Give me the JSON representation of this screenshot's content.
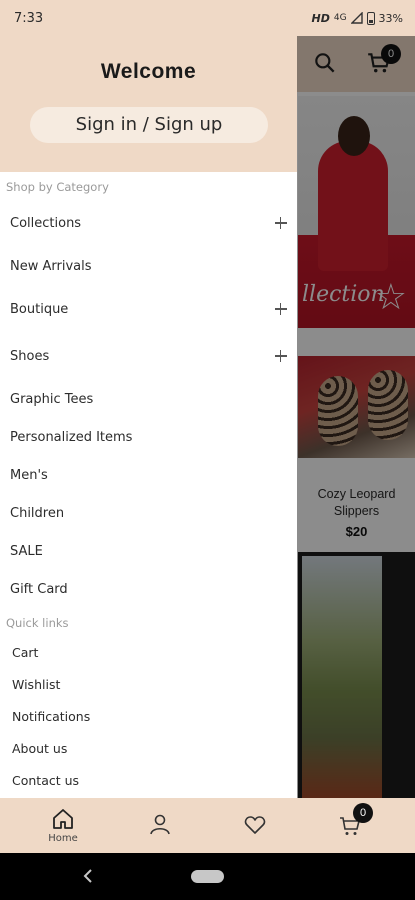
{
  "status_bar": {
    "time": "7:33",
    "network": "HD",
    "signal": "4G",
    "battery": "33%"
  },
  "header": {
    "cart_count": "0"
  },
  "drawer": {
    "welcome": "Welcome",
    "signin_label": "Sign in / Sign up",
    "category_title": "Shop by Category",
    "categories": [
      {
        "label": "Collections",
        "expandable": true
      },
      {
        "label": "New Arrivals",
        "expandable": false
      },
      {
        "label": "Boutique",
        "expandable": true
      },
      {
        "label": "Shoes",
        "expandable": true
      },
      {
        "label": "Graphic Tees",
        "expandable": false
      },
      {
        "label": "Personalized Items",
        "expandable": false
      },
      {
        "label": "Men's",
        "expandable": false
      },
      {
        "label": "Children",
        "expandable": false
      },
      {
        "label": "SALE",
        "expandable": false
      },
      {
        "label": "Gift Card",
        "expandable": false
      }
    ],
    "quick_links_title": "Quick links",
    "quick_links": [
      "Cart",
      "Wishlist",
      "Notifications",
      "About us",
      "Contact us"
    ]
  },
  "background_content": {
    "product_name": "Cozy Leopard Slippers",
    "product_price": "$20",
    "banner_script": "llection"
  },
  "bottom_nav": {
    "items": [
      {
        "label": "Home",
        "icon": "home-icon"
      },
      {
        "label": "",
        "icon": "profile-icon"
      },
      {
        "label": "",
        "icon": "heart-icon"
      },
      {
        "label": "",
        "icon": "cart-icon"
      }
    ],
    "cart_count": "0"
  },
  "colors": {
    "accent": "#efd9c6",
    "button_bg": "#f6ebe0",
    "badge": "#111111"
  }
}
